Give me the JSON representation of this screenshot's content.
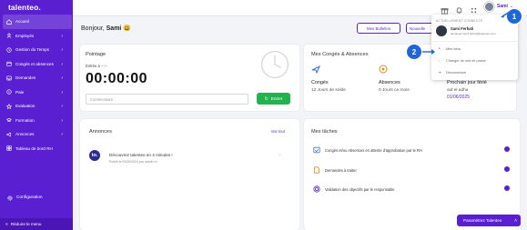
{
  "app": {
    "logo": "talenteo."
  },
  "sidebar": {
    "items": [
      {
        "label": "Accueil",
        "icon": "home-icon",
        "active": true,
        "chevron": ""
      },
      {
        "label": "Employés",
        "icon": "people-icon",
        "chevron": "›"
      },
      {
        "label": "Gestion du Temps",
        "icon": "clock-icon",
        "chevron": "›"
      },
      {
        "label": "Congés et absences",
        "icon": "calendar-icon",
        "chevron": "›"
      },
      {
        "label": "Demandes",
        "icon": "inbox-icon",
        "chevron": "›"
      },
      {
        "label": "Paie",
        "icon": "money-icon",
        "chevron": "›"
      },
      {
        "label": "Evaluation",
        "icon": "star-icon",
        "chevron": "›"
      },
      {
        "label": "Formation",
        "icon": "cap-icon",
        "chevron": "›"
      },
      {
        "label": "Annonces",
        "icon": "megaphone-icon",
        "chevron": "›"
      },
      {
        "label": "Tableau de bord RH",
        "icon": "dashboard-icon",
        "chevron": ""
      }
    ],
    "config_label": "Configuration",
    "reduce_label": "Réduire le menu"
  },
  "header": {
    "user_name": "Sami",
    "user_chevron": "⌄"
  },
  "main": {
    "greeting_prefix": "Bonjour,",
    "greeting_name": "Sami",
    "greeting_emoji": "😃",
    "btn_requests": "Mes Bulletins",
    "btn_new": "Nouvelle"
  },
  "pointage": {
    "title": "Pointage",
    "entree_label": "Entrée à --:--",
    "timer": "00:00:00",
    "comment_placeholder": "Commentaire",
    "enter_button": "Entrer"
  },
  "conges": {
    "title": "Mes Congés & Absences",
    "conges_label": "Congés",
    "conges_value": "12 Jours de solde",
    "absences_label": "Absences",
    "absences_value": "0 Jours ce mois",
    "ferie_label": "Prochain jour férié",
    "ferie_name": "aid el adha",
    "ferie_date": "01/06/2025"
  },
  "annonces": {
    "title": "Annonces",
    "voir_tout": "Voir tout",
    "item_logo": "to.",
    "item_title": "Découvrez talenteo en 4 minutes !",
    "item_meta": "Publié le 00/00/2024 par admin rh"
  },
  "taches": {
    "title": "Mes tâches",
    "items": [
      {
        "text": "Congés et/ou Absences en attente d'approbation par le RH",
        "icon": "calendar-check-icon",
        "count": ""
      },
      {
        "text": "Demandes à traiter",
        "icon": "document-icon",
        "count": ""
      },
      {
        "text": "Validation des objectifs par le responsable",
        "icon": "target-icon",
        "count": ""
      }
    ]
  },
  "dropdown": {
    "section_label": "ACTUELLEMENT CONNECTÉ",
    "name": "Sami Ferhati",
    "email": "developer.sami.ferhati@talenteo.com",
    "items": [
      {
        "label": "Mes infos",
        "icon": "person-icon"
      },
      {
        "label": "Changer de mot de passe",
        "icon": "lock-icon"
      },
      {
        "label": "Déconnexion",
        "icon": "logout-icon"
      }
    ]
  },
  "annotations": {
    "badge_1": "1",
    "badge_2": "2"
  },
  "param_button": "Paramétrez Talenteo",
  "colors": {
    "brand": "#5a1fd1",
    "success": "#22b34e",
    "annotation": "#1f67d8"
  }
}
